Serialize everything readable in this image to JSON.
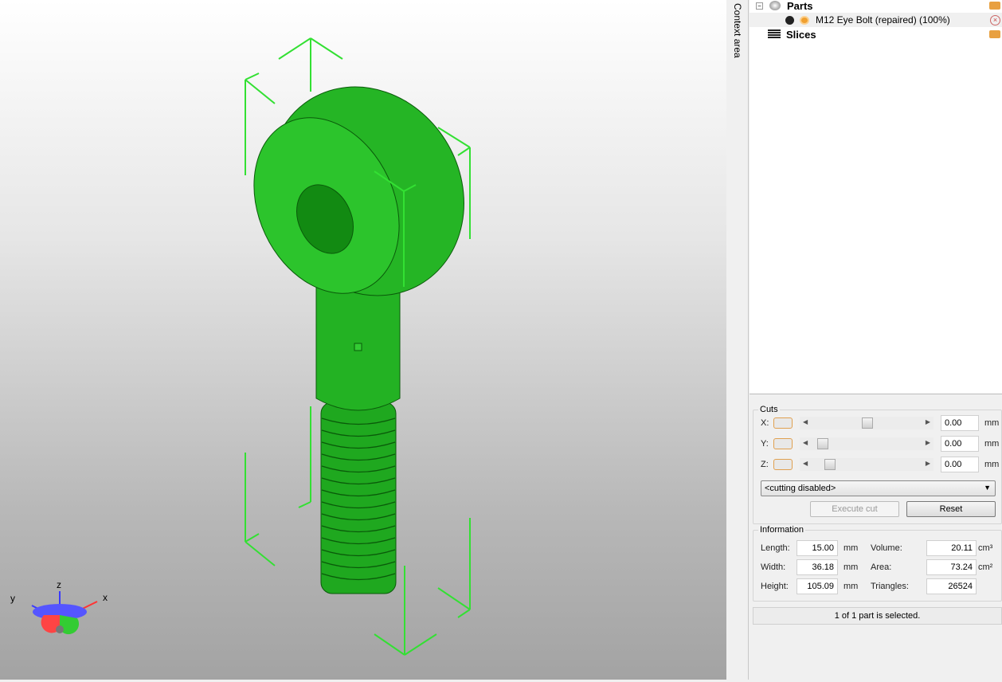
{
  "viewport": {
    "axes": {
      "x": "x",
      "y": "y",
      "z": "z"
    },
    "model_color": "#22bb22"
  },
  "context_area": {
    "label": "Context area"
  },
  "tree": {
    "parts_label": "Parts",
    "part_name": "M12 Eye Bolt (repaired) (100%)",
    "slices_label": "Slices"
  },
  "cuts": {
    "title": "Cuts",
    "rows": [
      {
        "axis": "X:",
        "value": "0.00",
        "unit": "mm",
        "slider": 0.5
      },
      {
        "axis": "Y:",
        "value": "0.00",
        "unit": "mm",
        "slider": 0.05
      },
      {
        "axis": "Z:",
        "value": "0.00",
        "unit": "mm",
        "slider": 0.12
      }
    ],
    "mode": "<cutting disabled>",
    "execute": "Execute cut",
    "reset": "Reset"
  },
  "info": {
    "title": "Information",
    "length_label": "Length:",
    "length": "15.00",
    "width_label": "Width:",
    "width": "36.18",
    "height_label": "Height:",
    "height": "105.09",
    "mm": "mm",
    "volume_label": "Volume:",
    "volume": "20.11",
    "volume_unit": "cm³",
    "area_label": "Area:",
    "area": "73.24",
    "area_unit": "cm²",
    "triangles_label": "Triangles:",
    "triangles": "26524"
  },
  "status": "1 of 1 part is selected."
}
